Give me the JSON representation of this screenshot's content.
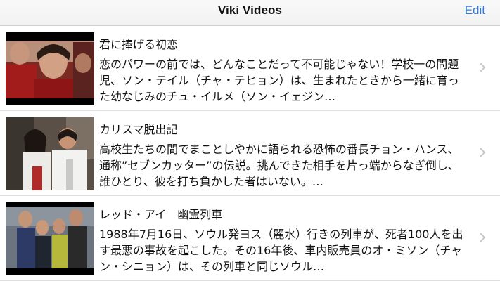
{
  "navbar": {
    "title": "Viki Videos",
    "edit_label": "Edit"
  },
  "videos": [
    {
      "title": "君に捧げる初恋",
      "description": "恋のパワーの前では、どんなことだって不可能じゃない！学校一の問題児、ソン・テイル（チャ・テヒョン）は、生まれたときから一緒に育った幼なじみのチュ・イルメ（ソン・イェジン…"
    },
    {
      "title": "カリスマ脱出記",
      "description": "高校生たちの間でまことしやかに語られる恐怖の番長チョン・ハンス、通称”セブンカッター”の伝説。挑んできた相手を片っ端からなぎ倒し、誰ひとり、彼を打ち負かした者はいない。…"
    },
    {
      "title": "レッド・アイ　幽霊列車",
      "description": "1988年7月16日、ソウル発ヨス（麗水）行きの列車が、死者100人を出す最悪の事故を起こした。その16年後、車内販売員のオ・ミソン（チャン・シニョン）は、その列車と同じソウル…"
    }
  ],
  "icons": {
    "chevron": "chevron-right-icon",
    "chevron_color": "#c7c7cc"
  },
  "colors": {
    "accent": "#2f7bdb"
  }
}
